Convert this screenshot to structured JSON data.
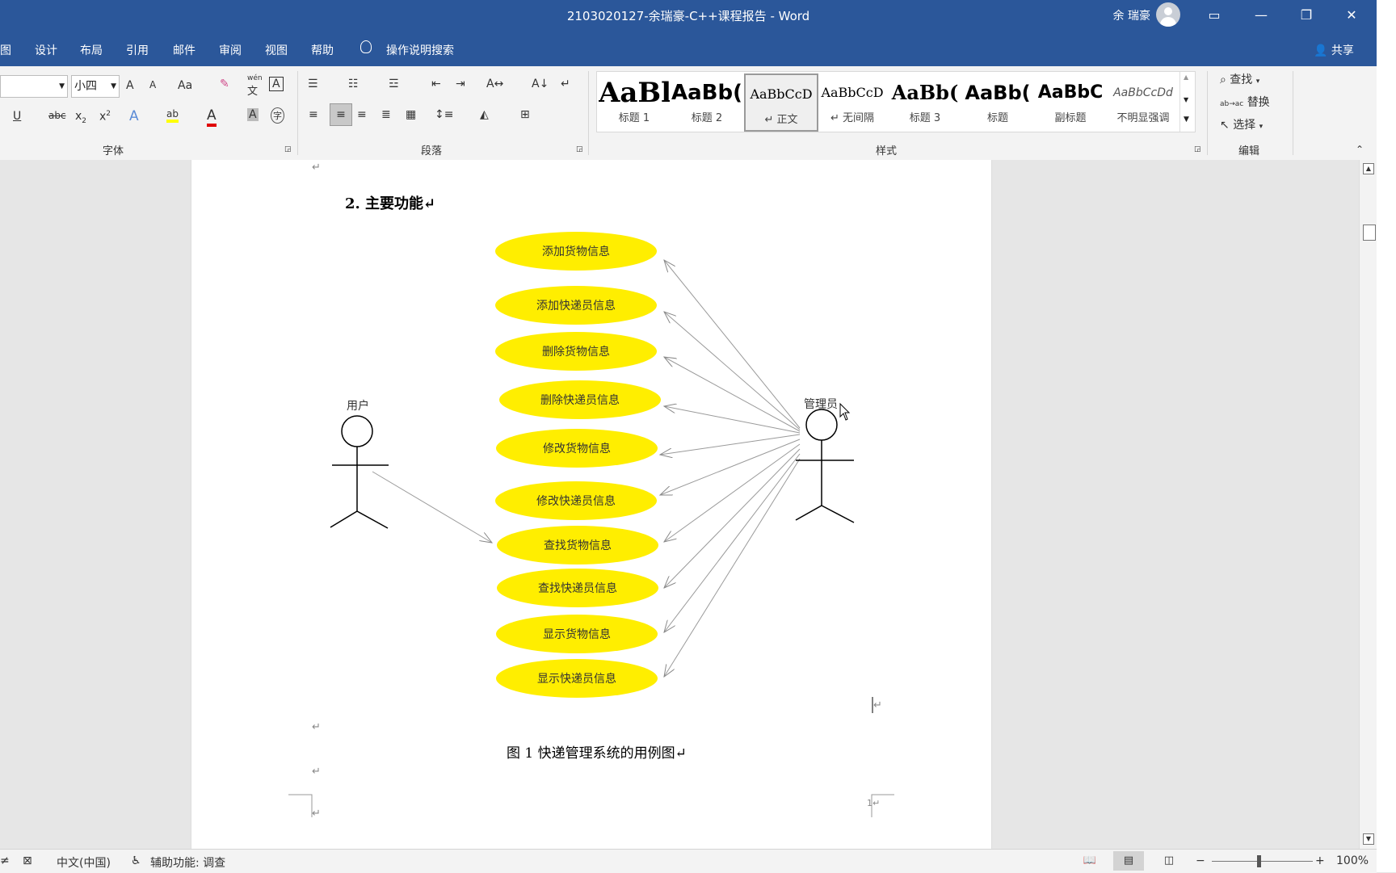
{
  "titlebar": {
    "title": "2103020127-余瑞豪-C++课程报告  -  Word",
    "user": "余 瑞豪",
    "buttons": {
      "ribbon_display": "▭",
      "minimize": "—",
      "restore": "❐",
      "close": "✕"
    }
  },
  "menubar": {
    "tabs": [
      "图",
      "设计",
      "布局",
      "引用",
      "邮件",
      "审阅",
      "视图",
      "帮助"
    ],
    "search": "操作说明搜索",
    "share": "共享"
  },
  "ribbon": {
    "font": {
      "name_value": "",
      "size_value": "小四",
      "grow": "A",
      "shrink": "A",
      "case": "Aa",
      "phonetic_top": "wén",
      "phonetic_bottom": "文",
      "border_char": "A",
      "underline": "U",
      "strike": "abc",
      "sub": "x",
      "sub_small": "2",
      "sup": "x",
      "sup_small": "2",
      "effects": "A",
      "highlight": "ab",
      "color": "A",
      "shade": "A",
      "enclose": "字",
      "label": "字体"
    },
    "paragraph": {
      "label": "段落"
    },
    "styles": {
      "label": "样式",
      "items": [
        {
          "preview": "AaBl",
          "name": "标题 1"
        },
        {
          "preview": "AaBb(",
          "name": "标题 2"
        },
        {
          "preview": "AaBbCcD",
          "name": "↵ 正文"
        },
        {
          "preview": "AaBbCcD",
          "name": "↵ 无间隔"
        },
        {
          "preview": "AaBb(",
          "name": "标题 3"
        },
        {
          "preview": "AaBb(",
          "name": "标题"
        },
        {
          "preview": "AaBbC",
          "name": "副标题"
        },
        {
          "preview": "AaBbCcDd",
          "name": "不明显强调"
        }
      ]
    },
    "editing": {
      "label": "编辑",
      "find": "查找",
      "replace": "替换",
      "select": "选择",
      "replace_icon": "ab→ac"
    }
  },
  "document": {
    "heading": "2. 主要功能↵",
    "para_mark": "↵",
    "page_number": "1↵",
    "caption": "图 1  快递管理系统的用例图↵",
    "diagram": {
      "actor_user": "用户",
      "actor_admin": "管理员",
      "use_cases": [
        "添加货物信息",
        "添加快递员信息",
        "删除货物信息",
        "删除快递员信息",
        "修改货物信息",
        "修改快递员信息",
        "查找货物信息",
        "查找快递员信息",
        "显示货物信息",
        "显示快递员信息"
      ],
      "ellipse_color": "#ffee00"
    }
  },
  "statusbar": {
    "language": "中文(中国)",
    "accessibility": "辅助功能: 调查",
    "zoom": "100%",
    "zoom_minus": "−",
    "zoom_plus": "+"
  },
  "colors": {
    "title_bg": "#2b579a",
    "ribbon_bg": "#f3f3f3",
    "highlight_yellow": "#ffff00",
    "font_red": "#e00000"
  }
}
